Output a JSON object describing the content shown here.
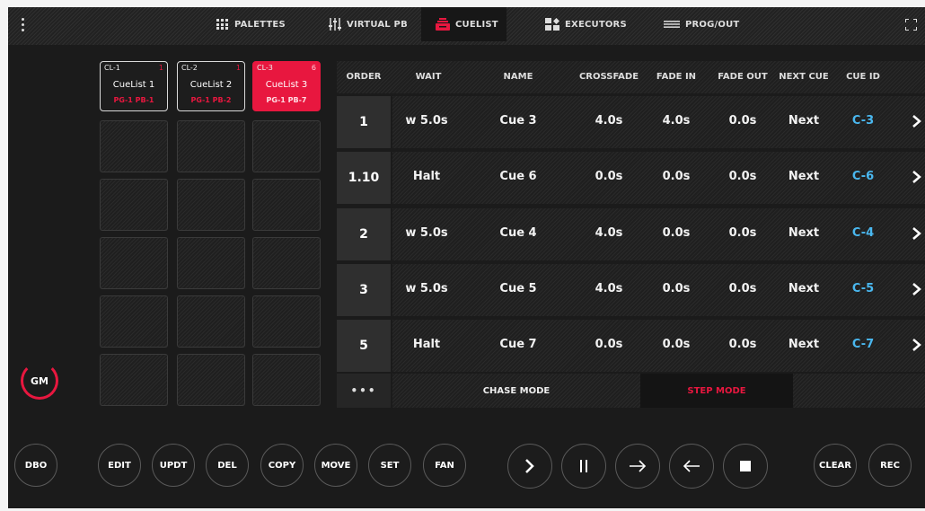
{
  "topbar": {
    "tabs": [
      {
        "label": "PALETTES",
        "icon": "palettes-grid-icon"
      },
      {
        "label": "VIRTUAL PB",
        "icon": "faders-icon"
      },
      {
        "label": "CUELIST",
        "icon": "cuelist-icon",
        "active": true
      },
      {
        "label": "EXECUTORS",
        "icon": "executors-icon"
      },
      {
        "label": "PROG/OUT",
        "icon": "prog-out-icon"
      }
    ]
  },
  "cuelists": [
    {
      "id": "CL-1",
      "count": "1",
      "name": "CueList 1",
      "pg": "PG-1 PB-1",
      "active": false
    },
    {
      "id": "CL-2",
      "count": "1",
      "name": "CueList 2",
      "pg": "PG-1 PB-2",
      "active": false
    },
    {
      "id": "CL-3",
      "count": "6",
      "name": "CueList 3",
      "pg": "PG-1 PB-7",
      "active": true
    }
  ],
  "gm_label": "GM",
  "table": {
    "headers": [
      "ORDER",
      "WAIT",
      "NAME",
      "CROSSFADE",
      "FADE IN",
      "FADE OUT",
      "NEXT CUE",
      "CUE ID"
    ],
    "rows": [
      {
        "order": "1",
        "wait": "w 5.0s",
        "name": "Cue 3",
        "crossfade": "4.0s",
        "fade_in": "4.0s",
        "fade_out": "0.0s",
        "next": "Next",
        "cue_id": "C-3"
      },
      {
        "order": "1.10",
        "wait": "Halt",
        "name": "Cue 6",
        "crossfade": "0.0s",
        "fade_in": "0.0s",
        "fade_out": "0.0s",
        "next": "Next",
        "cue_id": "C-6"
      },
      {
        "order": "2",
        "wait": "w 5.0s",
        "name": "Cue 4",
        "crossfade": "4.0s",
        "fade_in": "0.0s",
        "fade_out": "0.0s",
        "next": "Next",
        "cue_id": "C-4"
      },
      {
        "order": "3",
        "wait": "w 5.0s",
        "name": "Cue 5",
        "crossfade": "4.0s",
        "fade_in": "0.0s",
        "fade_out": "0.0s",
        "next": "Next",
        "cue_id": "C-5"
      },
      {
        "order": "5",
        "wait": "Halt",
        "name": "Cue 7",
        "crossfade": "0.0s",
        "fade_in": "0.0s",
        "fade_out": "0.0s",
        "next": "Next",
        "cue_id": "C-7"
      }
    ],
    "dots": "•••",
    "chase_mode": "CHASE MODE",
    "step_mode": "STEP MODE"
  },
  "buttons": {
    "dbo": "DBO",
    "edit": "EDIT",
    "updt": "UPDT",
    "del": "DEL",
    "copy": "COPY",
    "move": "MOVE",
    "set": "SET",
    "fan": "FAN",
    "clear": "CLEAR",
    "rec": "REC"
  },
  "colors": {
    "accent": "#e8173f",
    "cue_id": "#4ab8f0"
  }
}
